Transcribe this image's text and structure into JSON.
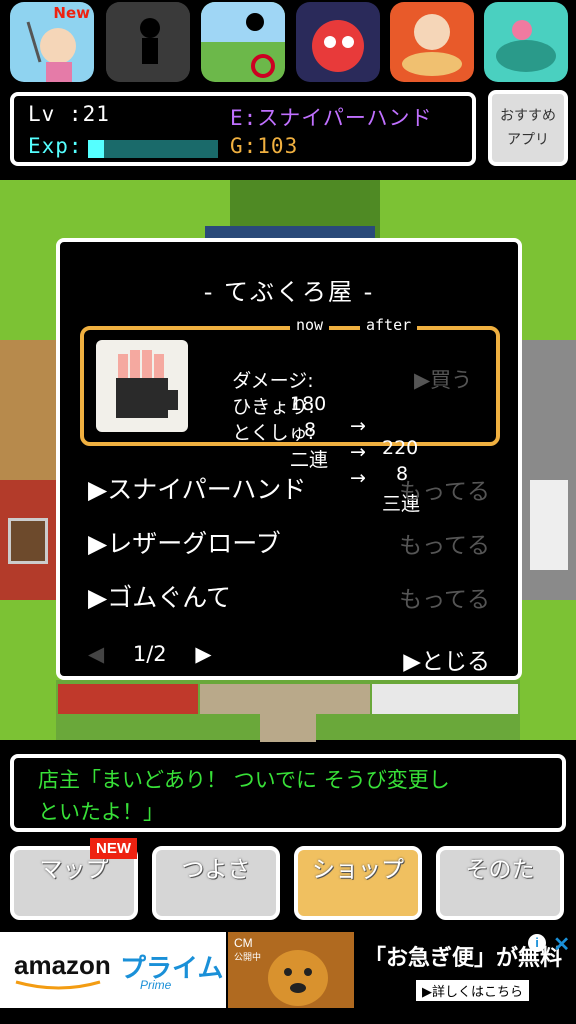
{
  "apps": [
    {
      "name": "app-1",
      "badge": "New",
      "bg": "#8fd3f0"
    },
    {
      "name": "app-2",
      "badge": "",
      "bg": "#333333"
    },
    {
      "name": "app-3",
      "badge": "",
      "bg": "#6cb84a"
    },
    {
      "name": "app-4",
      "badge": "",
      "bg": "#2a2a5a"
    },
    {
      "name": "app-5",
      "badge": "",
      "bg": "#e85a2a"
    },
    {
      "name": "app-6",
      "badge": "",
      "bg": "#4ad0c0"
    }
  ],
  "status": {
    "lv_label": "Lv :21",
    "exp_label": "Exp:",
    "exp_fraction": 0.12,
    "equip": "E:スナイパーハンド",
    "gold": "G:103",
    "colors": {
      "equip": "#c070ff",
      "gold": "#f0b040",
      "exp": "#5ff"
    }
  },
  "recommend": {
    "line1": "おすすめ",
    "line2": "アプリ"
  },
  "shop": {
    "title": "- てぶくろ屋 -",
    "now_label": "now",
    "after_label": "after",
    "stats": [
      {
        "name": "ダメージ:",
        "now": "180",
        "arrow": "→",
        "after": "220"
      },
      {
        "name": "ひきょり:",
        "now": "8",
        "arrow": "→",
        "after": "8"
      },
      {
        "name": "とくしゅ:",
        "now": "二連",
        "arrow": "→",
        "after": "三連"
      }
    ],
    "buy": "▶買う",
    "items": [
      {
        "label": "▶スナイパーハンド",
        "status": "もってる"
      },
      {
        "label": "▶レザーグローブ",
        "status": "もってる"
      },
      {
        "label": "▶ゴムぐんて",
        "status": "もってる"
      }
    ],
    "pager": {
      "prev": "◀",
      "page": "1/2",
      "next": "▶"
    },
    "close": "▶とじる"
  },
  "message": {
    "line1": "店主「まいどあり！ ついでに そうび変更し",
    "line2": "といたよ！」"
  },
  "nav": {
    "new_badge": "NEW",
    "buttons": [
      "マップ",
      "つよさ",
      "ショップ",
      "そのた"
    ]
  },
  "ad": {
    "amazon": "amazon",
    "prime": "プライム",
    "prime_sub": "Prime",
    "cm": "CM",
    "cm_sub": "公開中",
    "headline": "「お急ぎ便」が無料",
    "details": "▶詳しくはこちら"
  }
}
